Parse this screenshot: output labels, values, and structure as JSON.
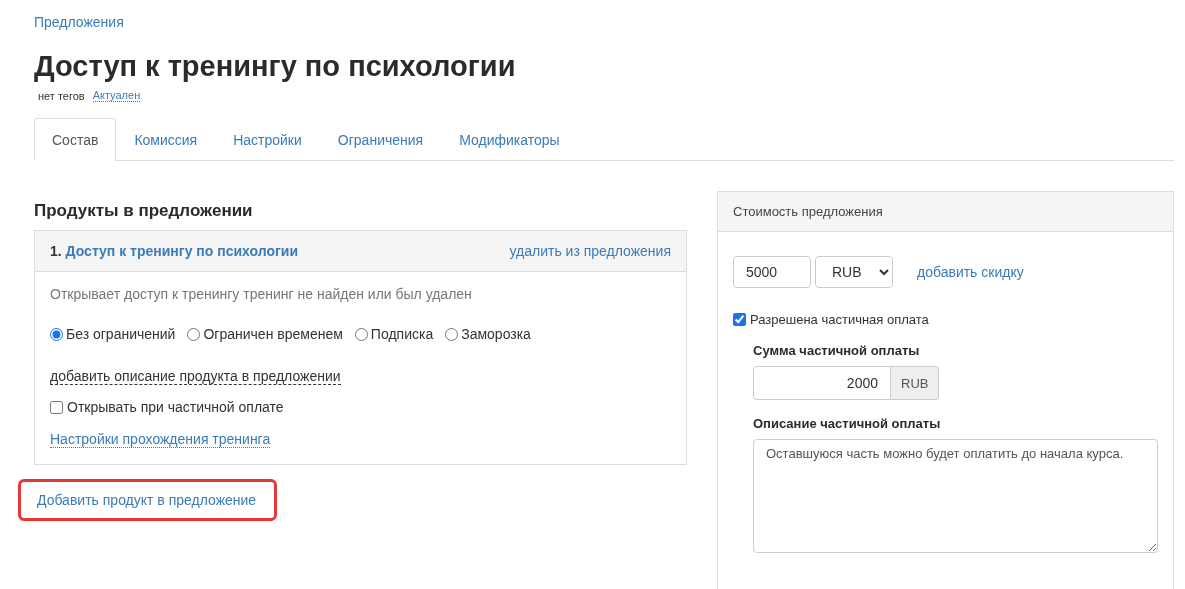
{
  "breadcrumb": "Предложения",
  "title": "Доступ к тренингу по психологии",
  "tags_label": "нет тегов",
  "status_link": "Актуален",
  "tabs": [
    {
      "label": "Состав",
      "selected": true
    },
    {
      "label": "Комиссия",
      "selected": false
    },
    {
      "label": "Настройки",
      "selected": false
    },
    {
      "label": "Ограничения",
      "selected": false
    },
    {
      "label": "Модификаторы",
      "selected": false
    }
  ],
  "products": {
    "heading": "Продукты в предложении",
    "items": [
      {
        "number": "1.",
        "name": "Доступ к тренингу по психологии",
        "remove_link": "удалить из предложения",
        "description": "Открывает доступ к тренингу тренинг не найден или был удален",
        "access_options": [
          {
            "label": "Без ограничений",
            "selected": true
          },
          {
            "label": "Ограничен временем",
            "selected": false
          },
          {
            "label": "Подписка",
            "selected": false
          },
          {
            "label": "Заморозка",
            "selected": false
          }
        ],
        "add_description_link": "добавить описание продукта в предложении",
        "open_on_partial": {
          "label": "Открывать при частичной оплате",
          "checked": false
        },
        "settings_link": "Настройки прохождения тренинга"
      }
    ]
  },
  "add_product": {
    "label": "Добавить продукт в предложение",
    "highlighted": true
  },
  "price": {
    "title": "Стоимость предложения",
    "amount": "5000",
    "currency": "RUB",
    "discount_link": "добавить скидку",
    "partial_payment": {
      "label": "Разрешена частичная оплата",
      "checked": true
    },
    "partial_amount": {
      "label": "Сумма частичной оплаты",
      "value": "2000",
      "currency": "RUB"
    },
    "partial_description": {
      "label": "Описание частичной оплаты",
      "value": "Оставшуюся часть можно будет оплатить до начала курса."
    }
  }
}
